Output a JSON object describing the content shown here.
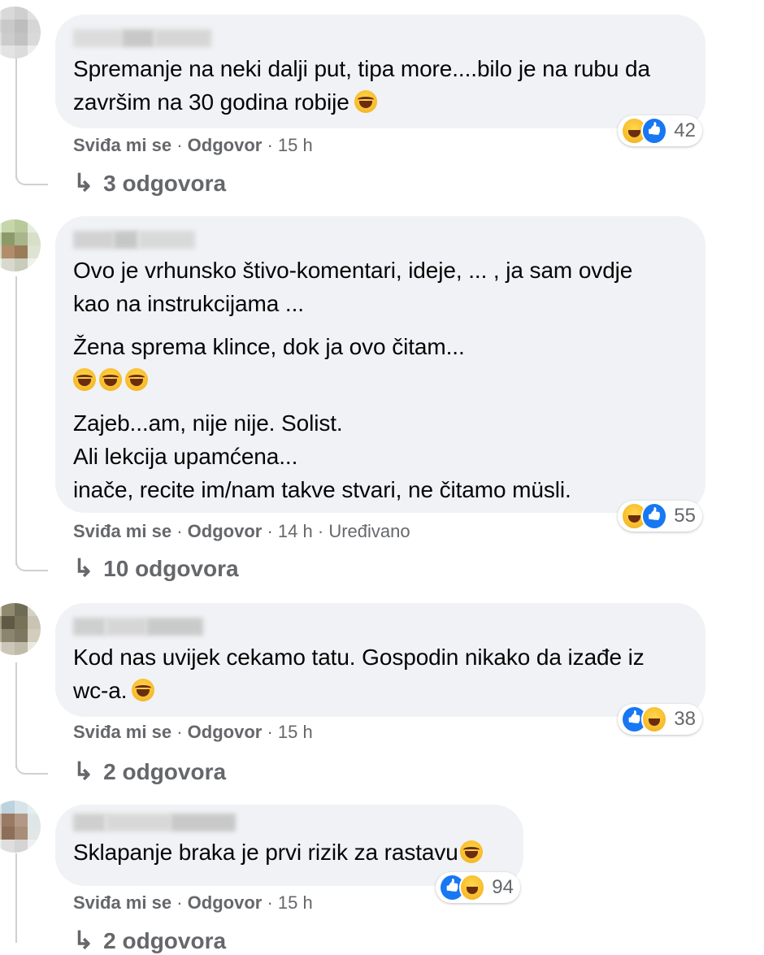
{
  "comments": [
    {
      "paragraphs": [
        "Spremanje na neki dalji put, tipa more....bilo je na rubu da završim na 30 godina robije"
      ],
      "emoji_after": "😂",
      "reactions": [
        "haha",
        "like"
      ],
      "reaction_count": "42",
      "like": "Sviđa mi se",
      "reply": "Odgovor",
      "time": "15 h",
      "edited": "",
      "replies_label": "3 odgovora"
    },
    {
      "paragraphs": [
        "Ovo je vrhunsko štivo-komentari, ideje, ... , ja sam ovdje",
        "kao na instrukcijama ...",
        "Žena sprema klince, dok ja ovo čitam...",
        "Zajeb...am, nije nije. Solist.",
        "Ali lekcija upamćena...",
        "inače, recite im/nam takve stvari, ne čitamo müsli."
      ],
      "emoji_line": "😂😂😂",
      "reactions": [
        "haha",
        "like"
      ],
      "reaction_count": "55",
      "like": "Sviđa mi se",
      "reply": "Odgovor",
      "time": "14 h",
      "edited": "Uređivano",
      "replies_label": "10 odgovora"
    },
    {
      "paragraphs": [
        "Kod nas uvijek cekamo tatu. Gospodin nikako da izađe iz",
        "wc-a."
      ],
      "emoji_after": "😂",
      "reactions": [
        "like",
        "haha"
      ],
      "reaction_count": "38",
      "like": "Sviđa mi se",
      "reply": "Odgovor",
      "time": "15 h",
      "edited": "",
      "replies_label": "2 odgovora"
    },
    {
      "paragraphs": [
        "Sklapanje braka je prvi rizik za rastavu"
      ],
      "emoji_after": "😁",
      "reactions": [
        "like",
        "haha"
      ],
      "reaction_count": "94",
      "like": "Sviđa mi se",
      "reply": "Odgovor",
      "time": "15 h",
      "edited": "",
      "replies_label": "2 odgovora"
    }
  ],
  "separator": "·",
  "reply_arrow": "↳",
  "colors": {
    "bubble": "#f0f2f5",
    "meta": "#65676b",
    "like_blue": "#1877f2",
    "haha_yellow": "#f7b928"
  }
}
